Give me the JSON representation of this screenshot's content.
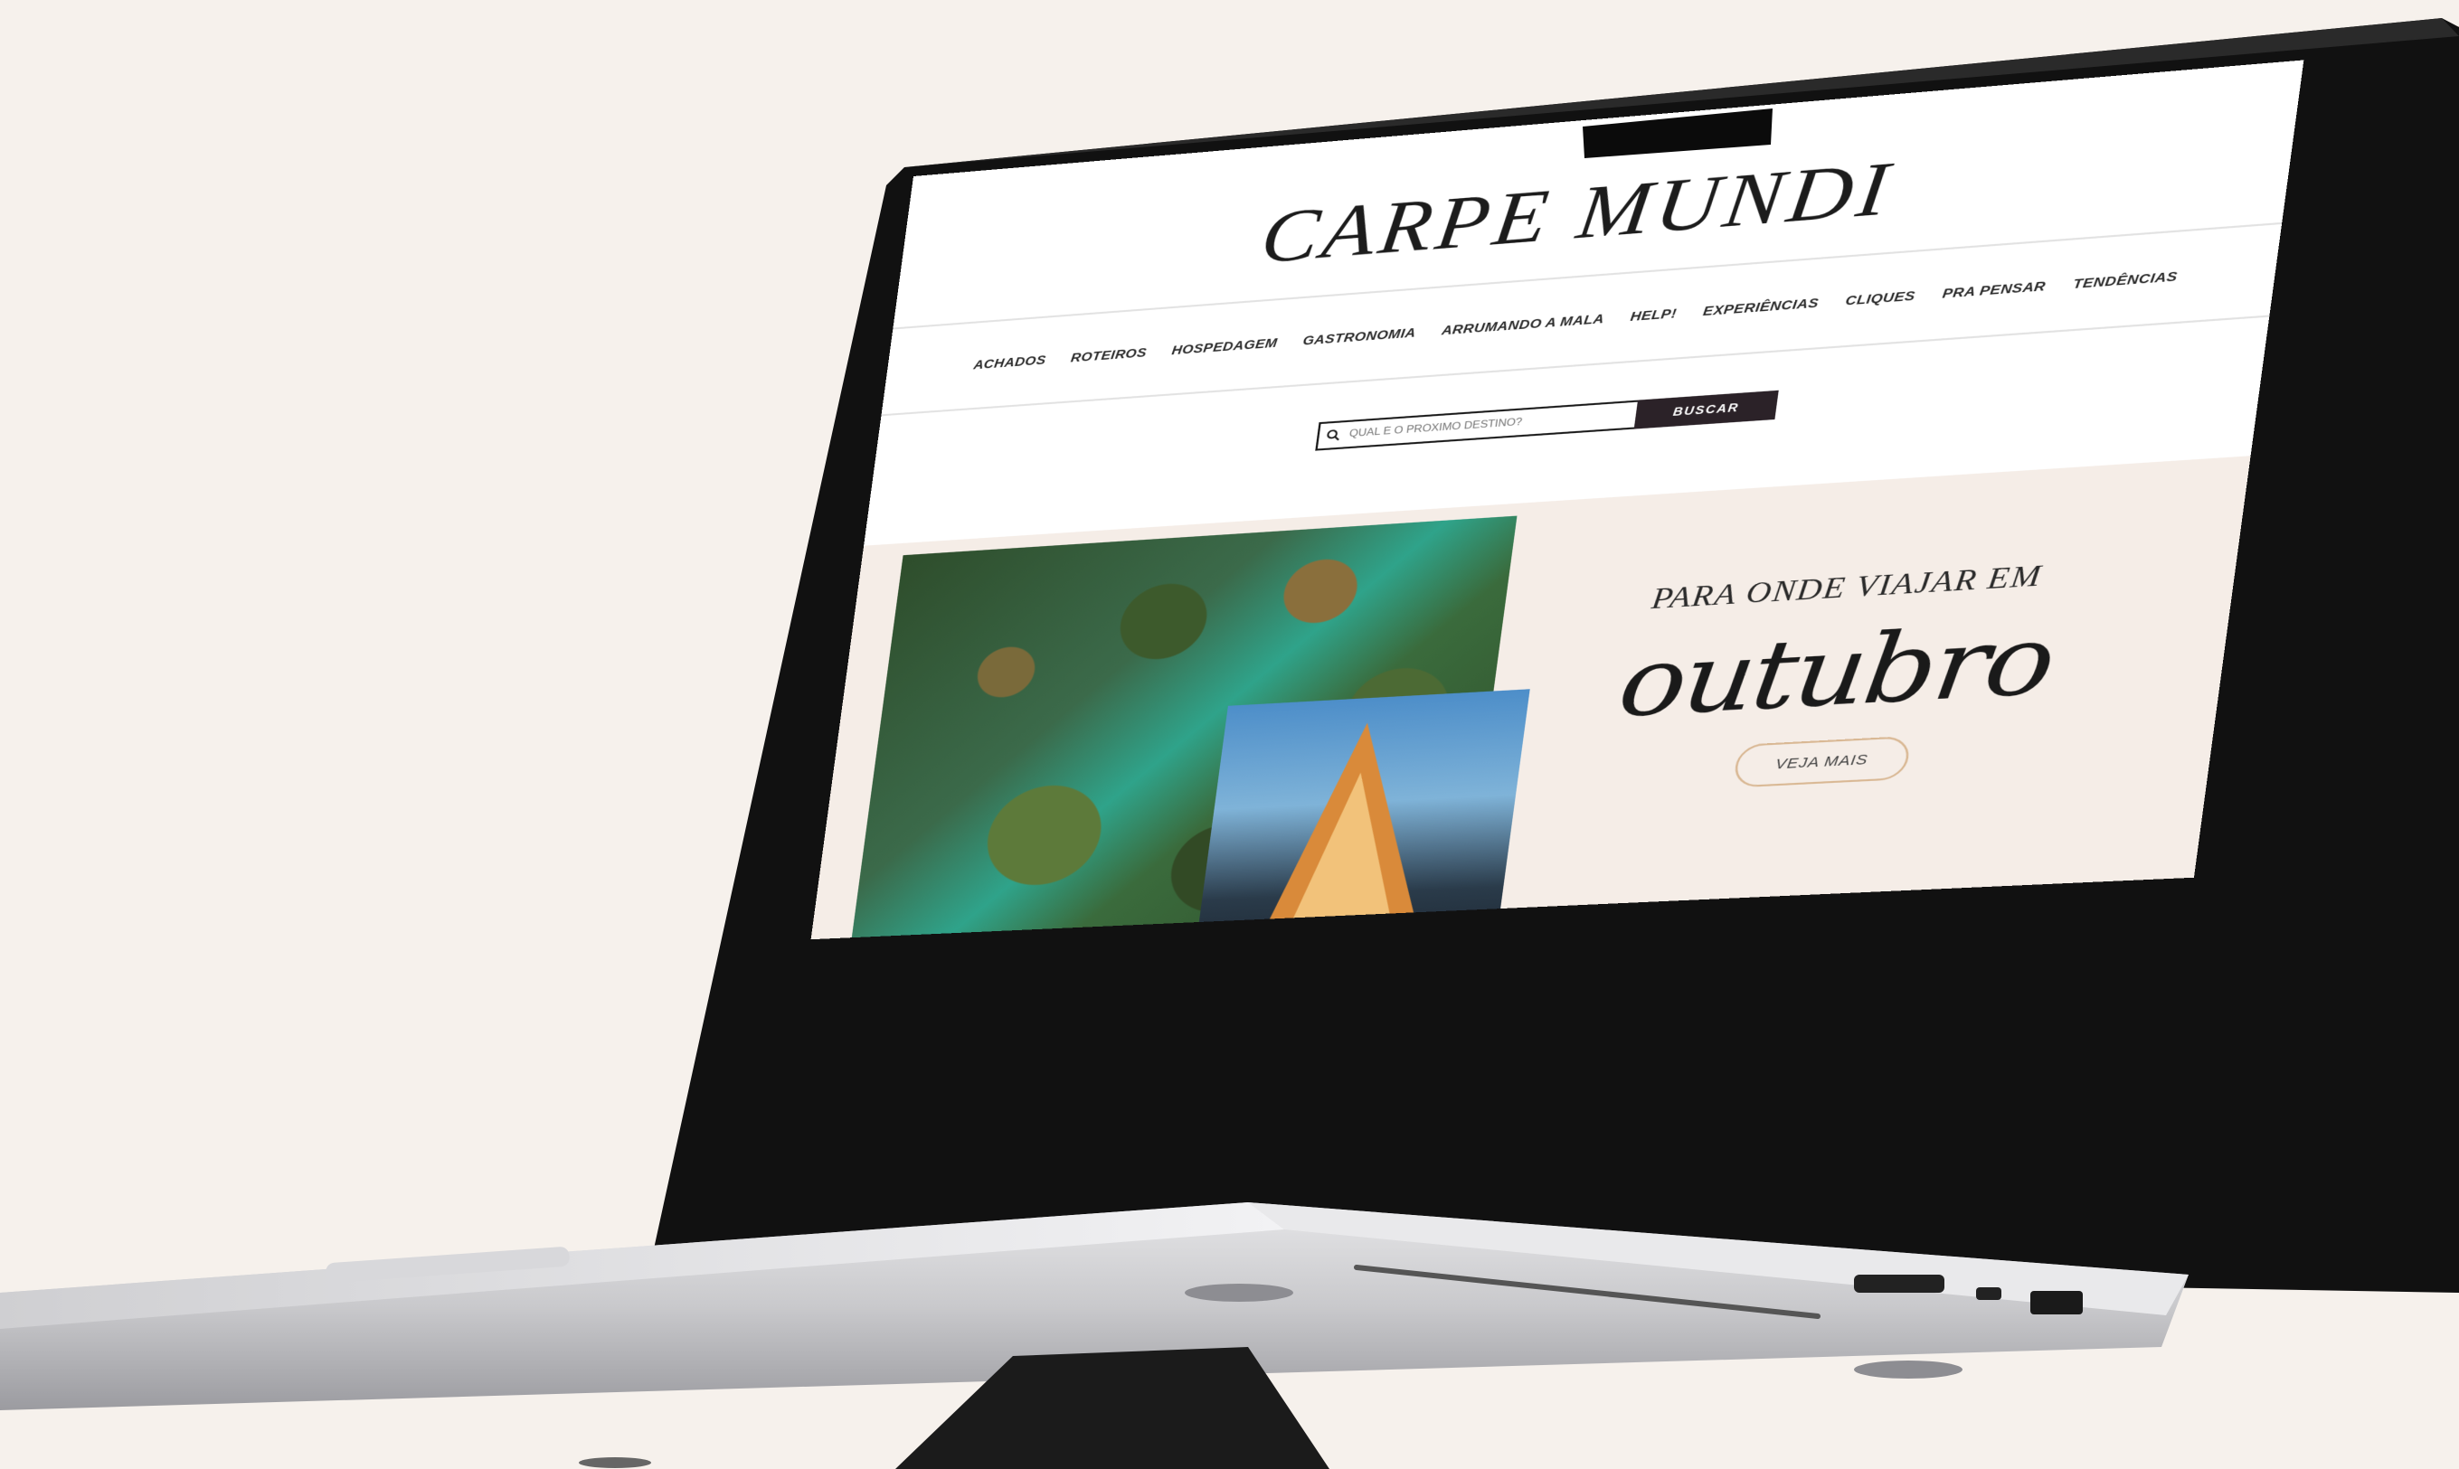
{
  "site": {
    "logo": "CARPE MUNDI"
  },
  "nav": {
    "items": [
      {
        "label": "ACHADOS"
      },
      {
        "label": "ROTEIROS"
      },
      {
        "label": "HOSPEDAGEM"
      },
      {
        "label": "GASTRONOMIA"
      },
      {
        "label": "ARRUMANDO A MALA"
      },
      {
        "label": "HELP!"
      },
      {
        "label": "EXPERIÊNCIAS"
      },
      {
        "label": "CLIQUES"
      },
      {
        "label": "PRA PENSAR"
      },
      {
        "label": "TENDÊNCIAS"
      }
    ]
  },
  "search": {
    "placeholder": "QUAL É O PRÓXIMO DESTINO?",
    "button_label": "BUSCAR"
  },
  "hero": {
    "kicker": "PARA ONDE VIAJAR EM",
    "script": "outubro",
    "button_label": "VEJA MAIS"
  },
  "colors": {
    "background": "#f6f1ec",
    "hero_bg": "#f5ede7",
    "search_button": "#2b2228",
    "accent_outline": "#d9b894"
  }
}
